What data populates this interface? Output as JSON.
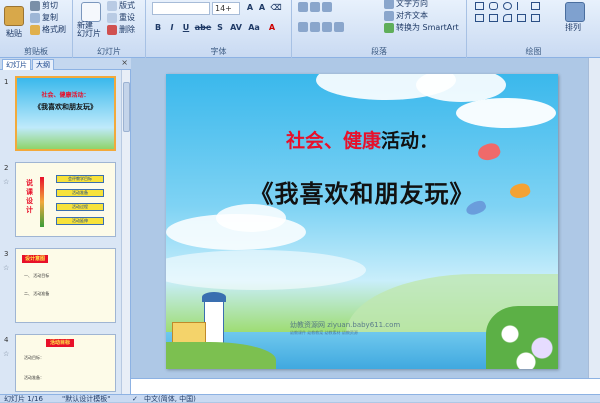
{
  "ribbon": {
    "clipboard": {
      "paste": "粘贴",
      "cut": "剪切",
      "copy": "复制",
      "format_painter": "格式刷",
      "group": "剪贴板"
    },
    "slides": {
      "new_slide": "新建\n幻灯片",
      "layout": "版式",
      "reset": "重设",
      "delete": "删除",
      "group": "幻灯片"
    },
    "font": {
      "font_size": "14+",
      "group": "字体",
      "bold": "B",
      "italic": "I",
      "underline": "U",
      "strike": "abe",
      "shadow": "S",
      "spacing": "AV",
      "case": "Aa",
      "color": "A"
    },
    "paragraph": {
      "text_direction": "文字方向",
      "align_text": "对齐文本",
      "smartart": "转换为 SmartArt",
      "group": "段落"
    },
    "drawing": {
      "arrange": "排列",
      "group": "绘图"
    }
  },
  "left_panel": {
    "tab_slides": "幻灯片",
    "tab_outline": "大纲",
    "close": "×",
    "thumbnails": [
      {
        "num": "1",
        "title_small": "社会、健康活动：",
        "subtitle_small": "《我喜欢和朋友玩》"
      },
      {
        "num": "2",
        "side_text": "说课设计",
        "items": [
          "会评教学目标",
          "活动准备",
          "活动过程",
          "活动延伸"
        ]
      },
      {
        "num": "3",
        "heading": "设计意图",
        "items": [
          "一、 活动目标",
          "二、 活动准备"
        ]
      },
      {
        "num": "4",
        "heading": "活动目标",
        "items": [
          "活动目标：",
          "活动准备："
        ]
      }
    ]
  },
  "slide": {
    "subtitle_red": "社会、健康",
    "subtitle_black": "活动：",
    "title": "《我喜欢和朋友玩》",
    "watermark": "幼教资源网 ziyuan.baby611.com",
    "watermark2": "幼教课件 幼教教案 幼教素材 幼教资源"
  },
  "status": {
    "slide_of": "幻灯片 1/16",
    "theme": "\"默认设计模板\"",
    "lang": "中文(简体, 中国)"
  },
  "colors": {
    "red_text": "#e8102a",
    "title": "#111111",
    "accent": "#f2a93b"
  }
}
